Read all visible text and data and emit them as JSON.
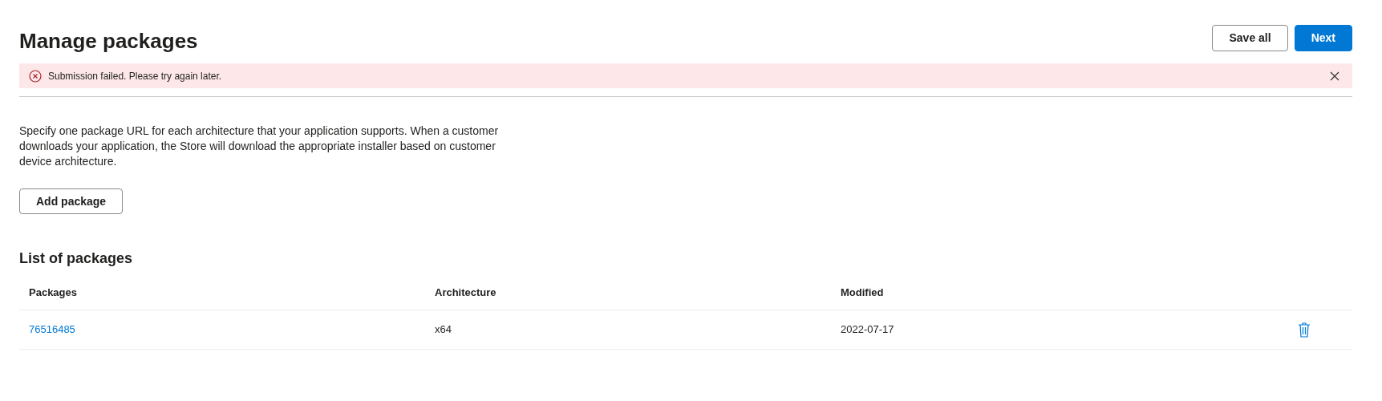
{
  "page": {
    "title": "Manage packages"
  },
  "actions": [
    {
      "label": "Save all",
      "kind": "secondary"
    },
    {
      "label": "Next",
      "kind": "primary"
    }
  ],
  "alert": {
    "message": "Submission failed. Please try again later."
  },
  "description": "Specify one package URL for each architecture that your application supports. When a customer downloads your application, the Store will download the appropriate installer based on customer device architecture.",
  "add_button": "Add package",
  "table": {
    "title": "List of packages",
    "columns": [
      "Packages",
      "Architecture",
      "Modified"
    ],
    "rows": [
      {
        "package": "76516485",
        "architecture": "x64",
        "modified": "2022-07-17"
      }
    ]
  }
}
